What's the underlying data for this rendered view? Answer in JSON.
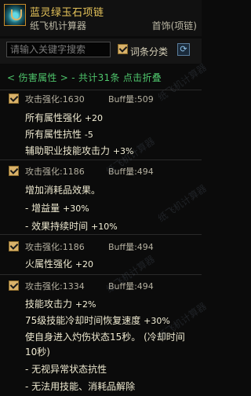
{
  "header": {
    "item_name": "蓝灵绿玉石项链",
    "subtitle": "纸飞机计算器",
    "slot": "首饰(项链)"
  },
  "search": {
    "placeholder": "请输入关键字搜索",
    "sort_label": "词条分类",
    "refresh_icon": "refresh-icon"
  },
  "group": {
    "text": "< 伤害属性 > - 共计31条 点击折叠"
  },
  "watermark": "纸飞机计算器",
  "entries": [
    {
      "enh": "攻击强化:1630",
      "buff": "Buff量:509",
      "lines": [
        {
          "text": "所有属性强化",
          "value": "+20"
        },
        {
          "text": "所有属性抗性",
          "value": "-5"
        },
        {
          "text": "辅助职业技能攻击力",
          "value": "+3%"
        }
      ]
    },
    {
      "enh": "攻击强化:1186",
      "buff": "Buff量:494",
      "lines": [
        {
          "text": "增加消耗品效果。",
          "value": ""
        },
        {
          "text": "- 增益量",
          "value": "+30%"
        },
        {
          "text": "- 效果持续时间",
          "value": "+10%"
        }
      ]
    },
    {
      "enh": "攻击强化:1186",
      "buff": "Buff量:494",
      "lines": [
        {
          "text": "火属性强化",
          "value": "+20"
        }
      ]
    },
    {
      "enh": "攻击强化:1334",
      "buff": "Buff量:494",
      "lines": [
        {
          "text": "技能攻击力",
          "value": "+2%"
        },
        {
          "text": "75级技能冷却时间恢复速度",
          "value": "+30%"
        },
        {
          "text": "使自身进入灼伤状态15秒。 (冷却时间",
          "value": ""
        },
        {
          "text": "10秒)",
          "value": ""
        },
        {
          "text": "- 无视异常状态抗性",
          "value": ""
        },
        {
          "text": "- 无法用技能、消耗品解除",
          "value": ""
        }
      ]
    }
  ]
}
